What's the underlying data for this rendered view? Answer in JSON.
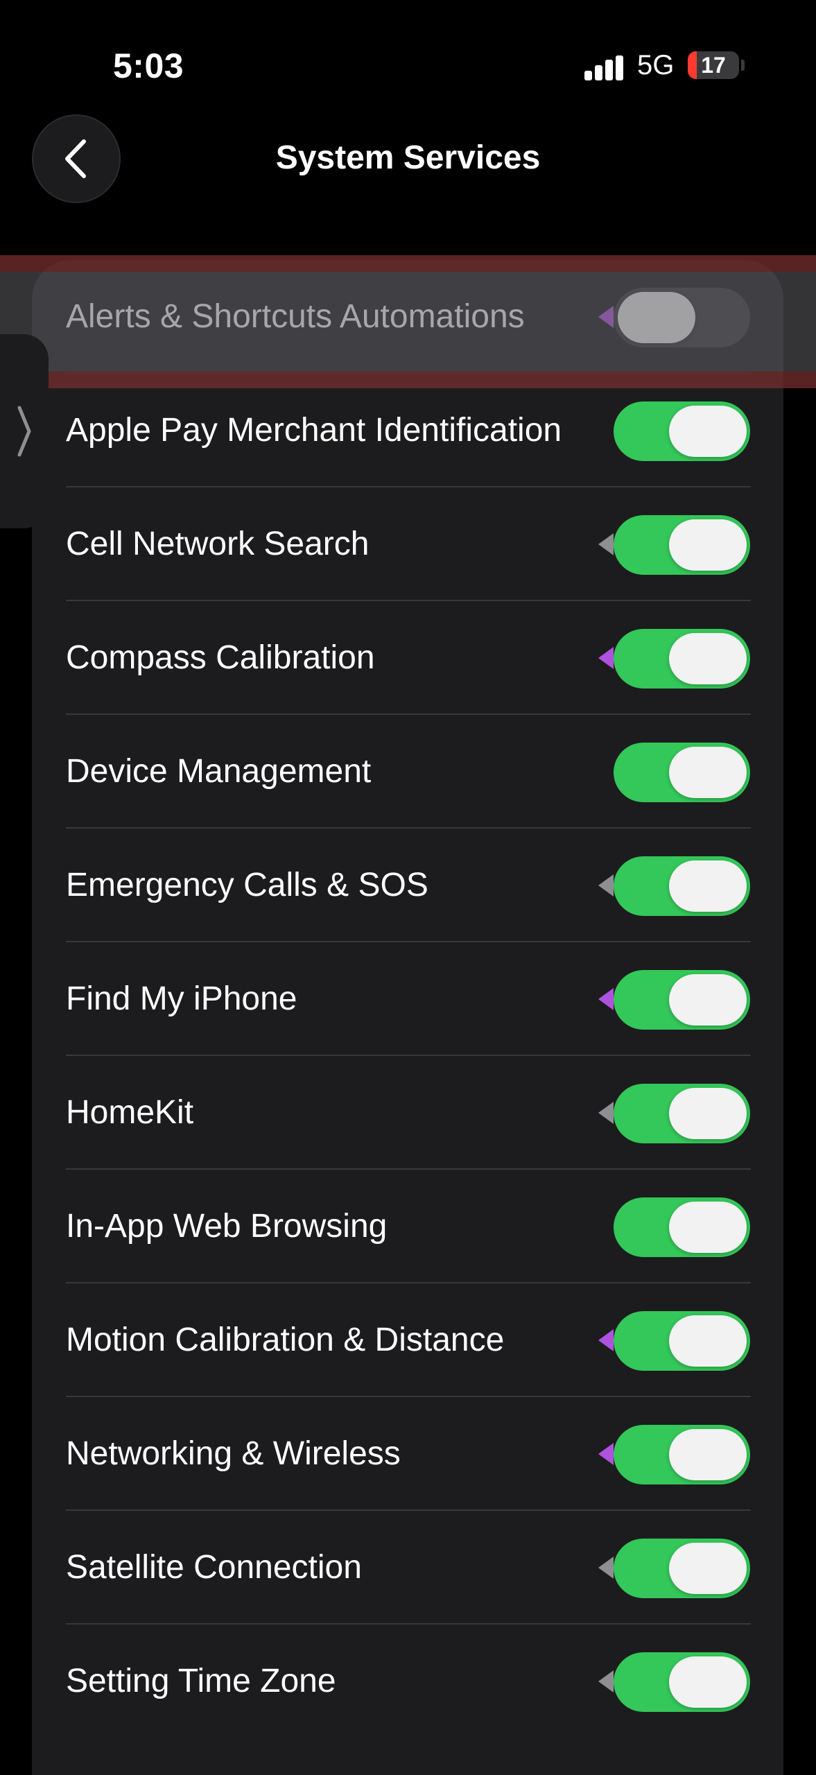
{
  "status_bar": {
    "time": "5:03",
    "network": "5G",
    "battery_level": "17",
    "battery_fraction": 0.17,
    "signal_bars_active": 3,
    "signal_bars_total": 4
  },
  "nav": {
    "back_icon": "chevron-left-icon",
    "title": "System Services"
  },
  "side_handle_icon": "chevron-right-icon",
  "colors": {
    "toggle_on": "#34c759",
    "toggle_off": "#3a3a3c",
    "location_arrow_purple": "#af52de",
    "location_arrow_gray": "#8e8e93"
  },
  "services": [
    {
      "label": "Alerts & Shortcuts Automations",
      "enabled": false,
      "location_arrow": "purple"
    },
    {
      "label": "Apple Pay Merchant Identification",
      "enabled": true,
      "location_arrow": "none"
    },
    {
      "label": "Cell Network Search",
      "enabled": true,
      "location_arrow": "gray"
    },
    {
      "label": "Compass Calibration",
      "enabled": true,
      "location_arrow": "purple"
    },
    {
      "label": "Device Management",
      "enabled": true,
      "location_arrow": "none"
    },
    {
      "label": "Emergency Calls & SOS",
      "enabled": true,
      "location_arrow": "gray"
    },
    {
      "label": "Find My iPhone",
      "enabled": true,
      "location_arrow": "purple"
    },
    {
      "label": "HomeKit",
      "enabled": true,
      "location_arrow": "gray"
    },
    {
      "label": "In-App Web Browsing",
      "enabled": true,
      "location_arrow": "none"
    },
    {
      "label": "Motion Calibration & Distance",
      "enabled": true,
      "location_arrow": "purple"
    },
    {
      "label": "Networking & Wireless",
      "enabled": true,
      "location_arrow": "purple"
    },
    {
      "label": "Satellite Connection",
      "enabled": true,
      "location_arrow": "gray"
    },
    {
      "label": "Setting Time Zone",
      "enabled": true,
      "location_arrow": "gray"
    }
  ]
}
